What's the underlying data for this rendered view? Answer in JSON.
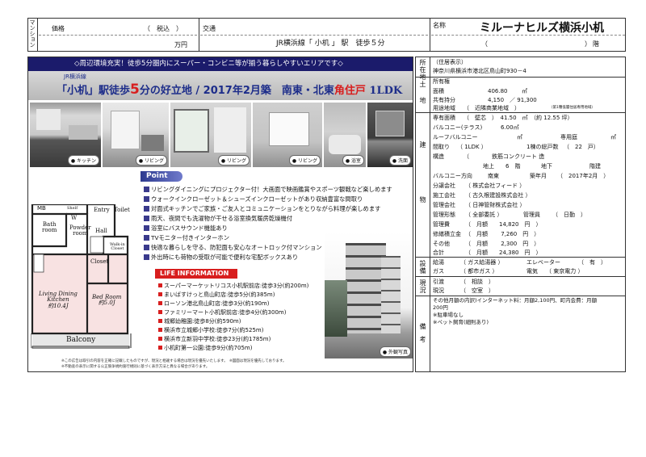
{
  "header": {
    "category": "マンション",
    "price_label": "価格",
    "tax_label": "（　税込　）",
    "price_unit": "万円",
    "transport_label": "交通",
    "transport_value": "JR横浜線「 小机 」 駅　徒歩５分",
    "name_label": "名称",
    "name_value": "ミルーナヒルズ横浜小机",
    "room_paren": "（　　　　　　　　　　　　　　　）",
    "room_suffix": "階"
  },
  "banner": {
    "top_text": "◇周辺環境充実！徒歩5分圏内にスーパー・コンビニ等が揃う暮らしやすいエリアです◇",
    "line_label": "JR横浜線",
    "headline_a": "「小机」駅徒歩",
    "headline_num": "5",
    "headline_b": "分の好立地 / 2017年2月築　南東・北東",
    "headline_red": "角住戸",
    "headline_c": " 1LDK"
  },
  "photos": [
    "キッチン",
    "リビング",
    "リビング",
    "浴室",
    "洗面"
  ],
  "floorplan": {
    "mb": "MB",
    "shelf": "Shelf",
    "entry": "Entry",
    "bath": "Bath\nroom",
    "w": "W",
    "powder": "Powder\nroom",
    "hall": "Hall",
    "toilet": "Toilet",
    "closet": "Closet",
    "walkin": "Walk-in\nCloset",
    "ldk": "Living Dining\nKitchen",
    "ldk_size": "約10.4J",
    "bed": "Bed Room",
    "bed_size": "約5.0J",
    "balcony": "Balcony"
  },
  "point": {
    "title": "Point",
    "items": [
      "リビングダイニングにプロジェクター付！大画面で映画鑑賞やスポーツ観戦など楽しめます",
      "ウォークインクローゼット＆シューズインクローゼットがあり収納豊富な間取り",
      "対面式キッチンでご家族・ご友人とコミュニケーションをとりながら料理が楽しめます",
      "雨天、夜間でも洗濯物が干せる浴室換気暖房乾燥機付",
      "浴室にバスサウンド機能あり",
      "TVモニター付きインターホン",
      "快適な暮らしを守る、防犯面も安心なオートロック付マンション",
      "外出時にも荷物の受取が可能で便利な宅配ボックスあり"
    ]
  },
  "life": {
    "title": "LIFE INFORMATION",
    "items": [
      "スーパーマーケットリコス小机駅前店:徒歩3分(約200m)",
      "まいばすけっと鳥山町店:徒歩5分(約385m)",
      "ローソン港北鳥山町店:徒歩3分(約190m)",
      "ファミリーマート小机駅前店:徒歩4分(約300m)",
      "城郷幼稚園:徒歩8分(約590m)",
      "横浜市立城郷小学校:徒歩7分(約525m)",
      "横浜市立新羽中学校:徒歩23分(約1785m)",
      "小机町第一公園:徒歩9分(約705m)"
    ],
    "exterior_caption": "外観写真"
  },
  "footnote": [
    "※この広告は取引の内容を正確に記載したものですが、現況と相違する場合は現況を優先いたします。　※図面は現況を優先しております。",
    "※不動産の表示に関する公正競争規約施行規則に基づく表示方法と異なる場合があります。"
  ],
  "right": {
    "loc_label": "所在地",
    "address_header": "（住居表示）",
    "address": "神奈川県横浜市港北区鳥山町930－4",
    "land_label": "土地",
    "ownership": "所有権",
    "land_area_label": "面積",
    "land_area": "406.80",
    "land_area_unit": "㎡",
    "share_label": "共有持分",
    "share": "4,150　／ 91,300",
    "zoning_label": "用途地域",
    "zoning": "（　近隣商業地域　）",
    "zoning_note": "（第1種低層住居専用地域）",
    "building_label": "建物",
    "floor_area_label": "専有面積",
    "floor_area": "（　壁芯　）　41.50　㎡　（約 12.55 坪）",
    "balcony_label": "バルコニー(テラス)",
    "balcony": "6.00㎡",
    "roof_label": "ルーフバルコニー",
    "roof": "㎡",
    "garden_label": "専用庭",
    "garden": "㎡",
    "layout_label": "間取り",
    "layout": "（ 1LDK ）",
    "units_label": "1棟の総戸数",
    "units": "（　22　戸）",
    "structure_label": "構造",
    "structure": "（　　　　鉄筋コンクリート 造",
    "floors_above": "地上　　6　階",
    "floors_below": "地下",
    "floor_no": "階建",
    "direction_label": "バルコニー方向",
    "direction": "南東",
    "built_label": "築年月",
    "built": "（　2017年2月　）",
    "seller_label": "分譲会社",
    "seller": "（ 株式会社フィード ）",
    "builder_label": "施工会社",
    "builder": "（ 古久根建設株式会社 ）",
    "mgmt_label": "管理会社",
    "mgmt": "（ 日神管財株式会社 ）",
    "mgmt_form_label": "管理形態",
    "mgmt_form": "（ 全部委託 ）",
    "manager_label": "管理員",
    "manager": "（　日勤　）",
    "fee_label": "管理費",
    "fee": "（　月額　　14,820　円　）",
    "repair_label": "修繕積立金",
    "repair": "（　月額　　 7,260　円　）",
    "other_label": "その他",
    "other": "（　月額　　 2,300　円　）",
    "total_label": "合計",
    "total": "（　月額　　24,380　円　）",
    "facility_label": "設備",
    "water_label": "給湯",
    "water": "（ ガス給湯器 ）",
    "elev_label": "エレベーター",
    "elev": "（　有　）",
    "gas_label": "ガス",
    "gas": "（ 都市ガス ）",
    "elec_label": "電気",
    "elec": "（ 東京電力 ）",
    "status_label": "現況",
    "handover_label": "引渡",
    "handover": "（　相談　）",
    "current_label": "現況",
    "current": "（　空室　）",
    "remarks_label": "備考",
    "remarks": [
      "その他月額の内訳)インターネット料：月額2,100円、町内会費：月額",
      "200円",
      "※駐車場なし",
      "※ペット飼育(細則あり)"
    ]
  },
  "colors": {
    "banner_bg": "#1b1b6b",
    "headline_bg": "#c8c8c8",
    "accent_red": "#d81e1e",
    "point_blue": "#3a3a8c",
    "headline_blue": "#1d2d8a"
  }
}
